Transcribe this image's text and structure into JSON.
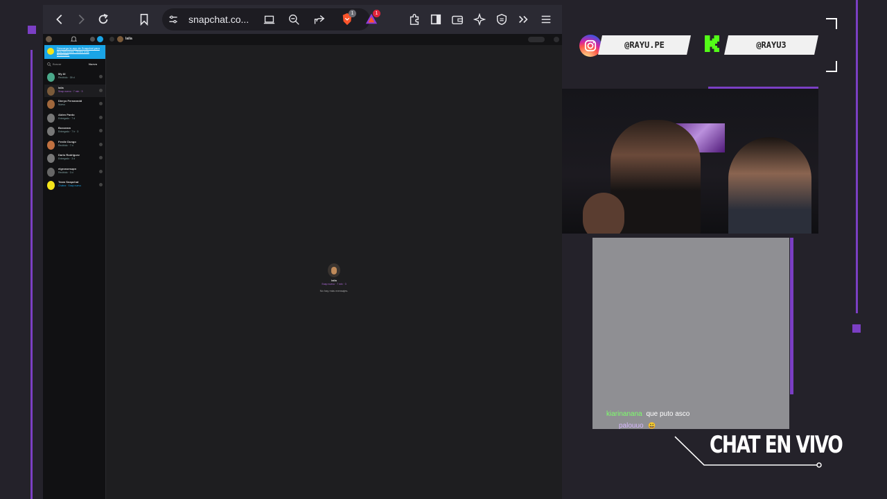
{
  "browser": {
    "url": "snapchat.co...",
    "brave_badge": "1",
    "rewards_badge": "1"
  },
  "snapchat": {
    "promo_text": "Descarga la app de Snapchat para Mac/Windows. Obtén más funciones.",
    "search_placeholder": "Buscar",
    "new_chat_label": "Nuevo",
    "active_chat_name": "laila",
    "chats": [
      {
        "name": "My AI",
        "sub": "Recibido · 39 d",
        "avatar_color": "#4aa88a",
        "sub_color": "#8aa"
      },
      {
        "name": "laila",
        "sub": "Snap nuevo · 7 min · 3",
        "avatar_color": "#7a5a3a",
        "sub_color": "#b06adb"
      },
      {
        "name": "Dieryo Fernanndd",
        "sub": "Nuevo",
        "avatar_color": "#a0673c",
        "sub_color": "#8aa"
      },
      {
        "name": "Aiden Pardo",
        "sub": "Entregado · 7 d",
        "avatar_color": "#777",
        "sub_color": "#8aa"
      },
      {
        "name": "Boxoeam",
        "sub": "Entregado · 7 h · 3",
        "avatar_color": "#777",
        "sub_color": "#8aa"
      },
      {
        "name": "Ferdie Dungo",
        "sub": "Recibido · 7 d",
        "avatar_color": "#c07040",
        "sub_color": "#8aa"
      },
      {
        "name": "Dario Rodriguez",
        "sub": "Entregado · 3 d",
        "avatar_color": "#777",
        "sub_color": "#8aa"
      },
      {
        "name": "elgrossesupn",
        "sub": "Recibido · 3 d",
        "avatar_color": "#666",
        "sub_color": "#8aa"
      },
      {
        "name": "Team Snapchat",
        "sub": "Chatea · Snap nuevo",
        "avatar_color": "#f5e51b",
        "sub_color": "#1aa4e6"
      }
    ],
    "center_name": "laila",
    "center_status": "Snap nuevo · 7 min · 3",
    "center_note": "No hay más mensajes."
  },
  "overlay": {
    "instagram_handle": "@RAYU.PE",
    "kick_handle": "@RAYU3",
    "chat_messages": [
      {
        "user": "kiarinanana",
        "text": "que puto asco",
        "user_color": "#7dff6b"
      },
      {
        "user": "palouuo",
        "text": "😃",
        "user_color": "#d7b8ff"
      }
    ],
    "chat_title": "CHAT EN VIVO"
  },
  "colors": {
    "accent_purple": "#7b3fc4",
    "snap_blue": "#1aa4e6",
    "kick_green": "#53fc18"
  }
}
